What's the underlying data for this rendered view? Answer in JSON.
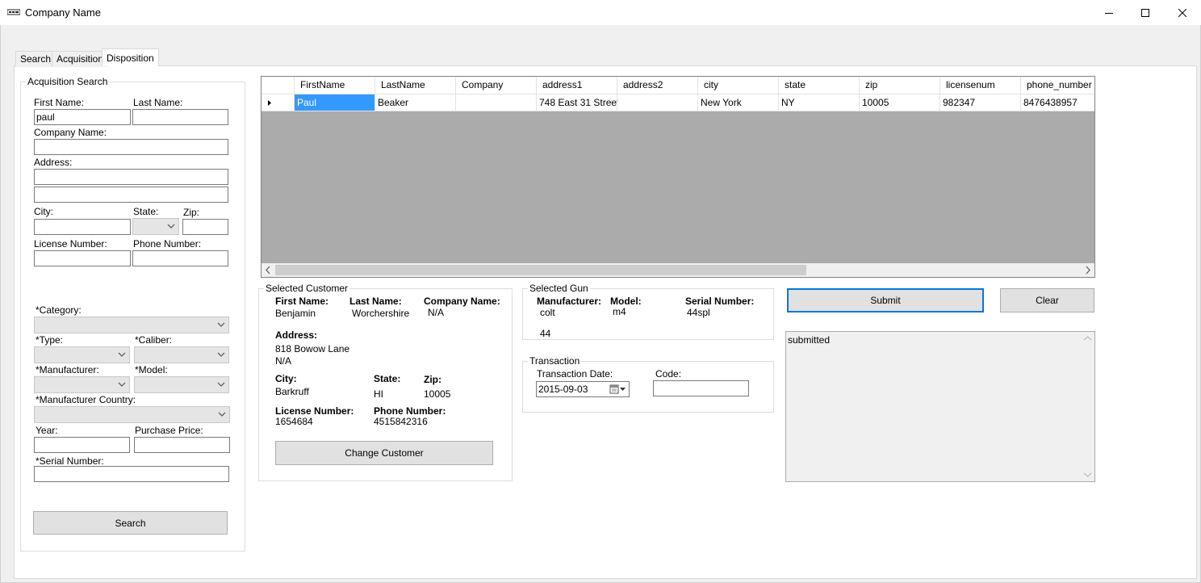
{
  "window": {
    "title": "Company Name"
  },
  "tabs": [
    {
      "label": "Search"
    },
    {
      "label": "Acquisition"
    },
    {
      "label": "Disposition"
    }
  ],
  "acquisition_search": {
    "group_title": "Acquisition Search",
    "first_name_label": "First Name:",
    "first_name_value": "paul",
    "last_name_label": "Last Name:",
    "last_name_value": "",
    "company_name_label": "Company Name:",
    "address_label": "Address:",
    "city_label": "City:",
    "state_label": "State:",
    "zip_label": "Zip:",
    "license_label": "License Number:",
    "phone_label": "Phone Number:",
    "category_label": "*Category:",
    "type_label": "*Type:",
    "caliber_label": "*Caliber:",
    "manufacturer_label": "*Manufacturer:",
    "model_label": "*Model:",
    "manufacturer_country_label": "*Manufacturer Country:",
    "year_label": "Year:",
    "purchase_price_label": "Purchase Price:",
    "serial_label": "*Serial Number:",
    "search_button": "Search"
  },
  "grid": {
    "columns": [
      "FirstName",
      "LastName",
      "Company",
      "address1",
      "address2",
      "city",
      "state",
      "zip",
      "licensenum",
      "phone_number"
    ],
    "rows": [
      [
        "Paul",
        "Beaker",
        "",
        "748 East 31 Street",
        "",
        "New York",
        "NY",
        "10005",
        "982347",
        "8476438957"
      ]
    ]
  },
  "selected_customer": {
    "group_title": "Selected Customer",
    "first_name_label": "First Name:",
    "first_name": "Benjamin",
    "last_name_label": "Last Name:",
    "last_name": "Worchershire",
    "company_name_label": "Company Name:",
    "company_name": "N/A",
    "address_label": "Address:",
    "address_line1": "818 Bowow Lane",
    "address_line2": "N/A",
    "city_label": "City:",
    "city": "Barkruff",
    "state_label": "State:",
    "state": "HI",
    "zip_label": "Zip:",
    "zip": "10005",
    "license_label": "License Number:",
    "license": "1654684",
    "phone_label": "Phone Number:",
    "phone": "4515842316",
    "change_button": "Change Customer"
  },
  "selected_gun": {
    "group_title": "Selected Gun",
    "manufacturer_label": "Manufacturer:",
    "manufacturer": "colt",
    "model_label": "Model:",
    "model": "m4",
    "serial_label": "Serial Number:",
    "serial": "44spl",
    "extra": "44"
  },
  "transaction": {
    "group_title": "Transaction",
    "date_label": "Transaction Date:",
    "date_value": "2015-09-03",
    "code_label": "Code:",
    "code_value": ""
  },
  "actions": {
    "submit_button": "Submit",
    "clear_button": "Clear"
  },
  "log": {
    "text": "submitted"
  },
  "colors": {
    "selection": "#3399ff",
    "focus_border": "#0078d7",
    "grid_background": "#ababab"
  }
}
